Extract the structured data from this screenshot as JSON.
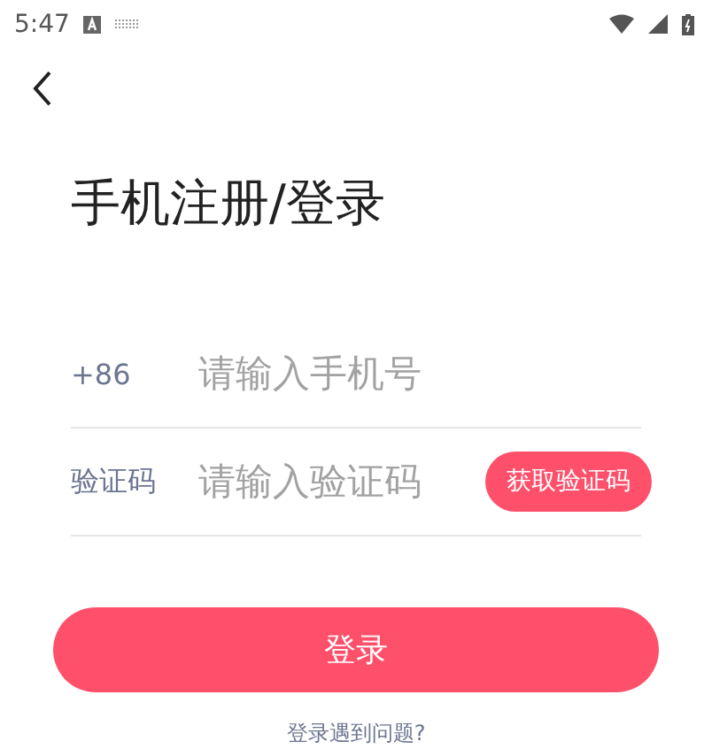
{
  "status_bar": {
    "time": "5:47"
  },
  "title": "手机注册/登录",
  "phone_row": {
    "label": "+86",
    "placeholder": "请输入手机号"
  },
  "code_row": {
    "label": "验证码",
    "placeholder": "请输入验证码",
    "button": "获取验证码"
  },
  "login_button": "登录",
  "help_link": "登录遇到问题?"
}
